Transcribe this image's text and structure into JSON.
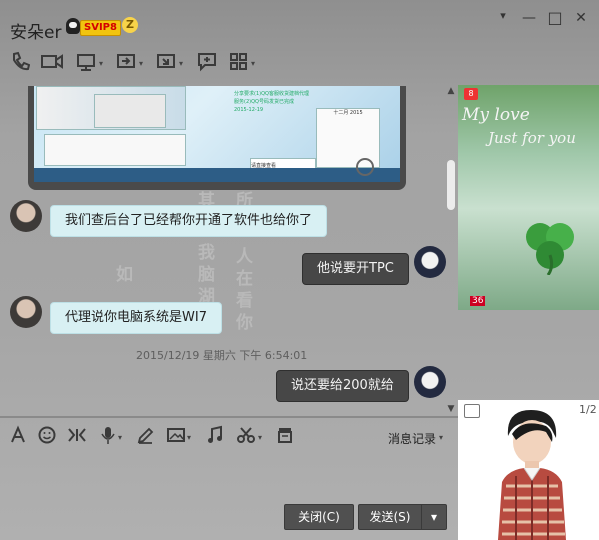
{
  "window": {
    "contact_name": "安朵er",
    "vip_label": "SVIP8",
    "level_label": "Z",
    "controls": {
      "minimize": "—",
      "maximize": "□",
      "close": "✕"
    }
  },
  "toolbar": {
    "items": [
      "phone-icon",
      "video-icon",
      "screen-share-icon",
      "remote-assist-icon",
      "file-transfer-icon",
      "message-icon",
      "apps-icon"
    ]
  },
  "chat": {
    "screenshot_preview": {
      "calendar_header": "十二月 2015",
      "task_line": "2015-12-19",
      "msg1": "分享要求(1)QQ客服收货建档代理",
      "msg2": "服务(2)QQ号码发货已完成",
      "note": "请直接查看"
    },
    "background_text": [
      "其",
      "所",
      "我",
      "人",
      "脑",
      "在",
      "湖",
      "看",
      "如",
      "你"
    ],
    "messages": [
      {
        "side": "left",
        "text": "我们查后台了已经帮你开通了软件也给你了"
      },
      {
        "side": "right",
        "text": "他说要开TPC"
      },
      {
        "side": "left",
        "text": "代理说你电脑系统是WI7"
      },
      {
        "side": "right",
        "text": "说还要给200就给"
      }
    ],
    "timestamp": "2015/12/19 星期六 下午 6:54:01"
  },
  "input_toolbar": {
    "items": [
      "font-icon",
      "emoji-icon",
      "gif-icon",
      "voice-icon",
      "pen-icon",
      "image-icon",
      "music-icon",
      "screenshot-icon",
      "history-file-icon"
    ],
    "history_label": "消息记录"
  },
  "buttons": {
    "close_label": "关闭(C)",
    "send_label": "发送(S)",
    "send_more": "▾"
  },
  "right_panel": {
    "badge_number": "8",
    "script_line1": "My love",
    "script_line2": "Just for you",
    "level_number": "36",
    "show_counter": "1/2"
  }
}
